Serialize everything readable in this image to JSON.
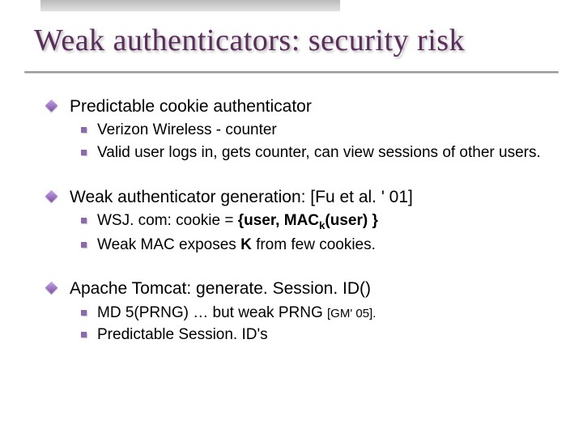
{
  "title": "Weak authenticators:  security risk",
  "blocks": [
    {
      "heading": "Predictable cookie authenticator",
      "items": [
        {
          "text": "Verizon Wireless  -  counter"
        },
        {
          "text": "Valid user logs in, gets counter, can view sessions of other users."
        }
      ]
    },
    {
      "heading": "Weak authenticator generation:    [Fu et al. ' 01]",
      "items": [
        {
          "prefix": "WSJ. com:          cookie = ",
          "bold_html": "{user,  MAC<sub>k</sub>(user) }"
        },
        {
          "prefix": "Weak MAC exposes  ",
          "bold_html": "K",
          "suffix": "  from few cookies."
        }
      ]
    },
    {
      "heading": "Apache Tomcat:    generate. Session. ID()",
      "items": [
        {
          "text": "MD 5(PRNG)   …   but weak PRNG   ",
          "cite": "[GM' 05]."
        },
        {
          "text": "Predictable Session. ID's"
        }
      ]
    }
  ]
}
